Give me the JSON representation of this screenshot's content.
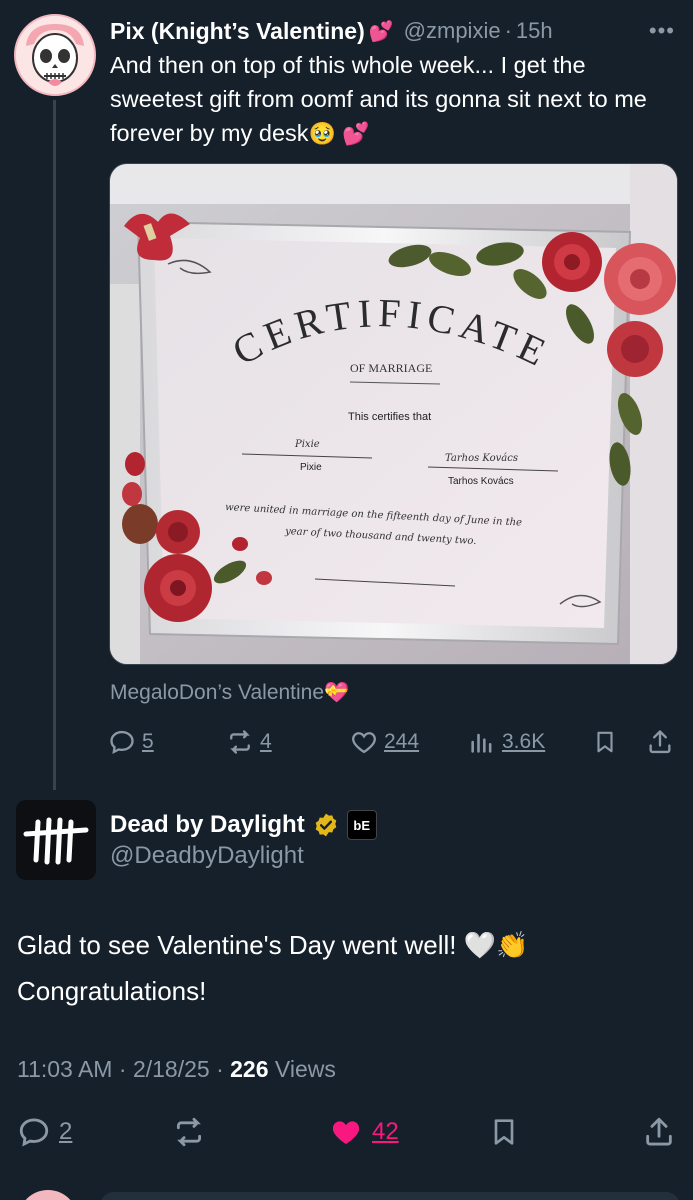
{
  "parent_tweet": {
    "display_name": "Pix (Knight’s Valentine)",
    "name_emoji": "💕",
    "handle": "@zmpixie",
    "separator": "·",
    "time": "15h",
    "more_icon": "more-icon",
    "text": "And then on top of this whole week... I get the sweetest gift from oomf and its gonna sit next to me forever by my desk",
    "text_emojis": "🥹 💕",
    "community_label": "MegaloDon’s Valentine",
    "community_emoji": "💝",
    "image": {
      "certificate_title": "CERTIFICATE",
      "certificate_subtitle": "OF MARRIAGE",
      "certifies": "This certifies that",
      "name_left_script": "Pixie",
      "name_left": "Pixie",
      "name_right_script": "Tarhos Kovács",
      "name_right": "Tarhos Kovács",
      "body_line1": "were united in marriage on the fifteenth day of June in the",
      "body_line2": "year of two thousand and twenty two."
    },
    "actions": {
      "replies": "5",
      "reposts": "4",
      "likes": "244",
      "views": "3.6K"
    }
  },
  "reply_tweet": {
    "display_name": "Dead by Daylight",
    "handle": "@DeadbyDaylight",
    "affiliate_badge": "bE",
    "text_line1": "Glad to see Valentine's Day went well! 🤍👏",
    "text_line2": "Congratulations!",
    "time": "11:03 AM",
    "date": "2/18/25",
    "views_count": "226",
    "views_label": "Views",
    "separator": "·",
    "actions": {
      "replies": "2",
      "likes": "42"
    }
  },
  "colors": {
    "background": "#15202b",
    "secondary_text": "#8b98a5",
    "like_pink": "#f91880",
    "verified_gold": "#e2b719"
  }
}
